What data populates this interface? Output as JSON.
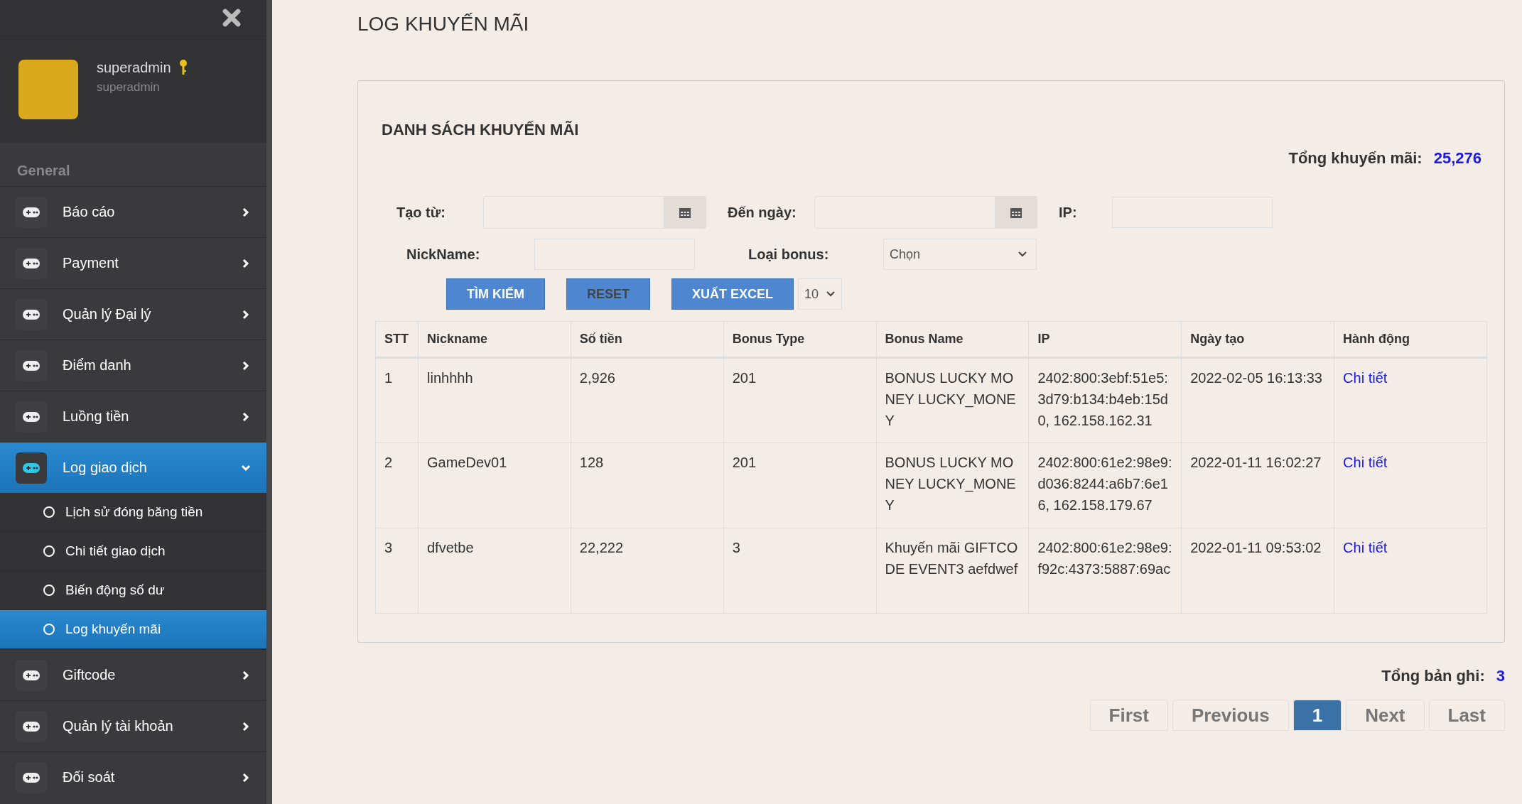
{
  "sidebar": {
    "user": {
      "name": "superadmin",
      "role": "superadmin"
    },
    "section": "General",
    "items": [
      {
        "label": "Báo cáo",
        "selected": false,
        "expanded": false
      },
      {
        "label": "Payment",
        "selected": false,
        "expanded": false
      },
      {
        "label": "Quản lý Đại lý",
        "selected": false,
        "expanded": false
      },
      {
        "label": "Điểm danh",
        "selected": false,
        "expanded": false
      },
      {
        "label": "Luồng tiền",
        "selected": false,
        "expanded": false
      },
      {
        "label": "Log giao dịch",
        "selected": true,
        "expanded": true,
        "children": [
          {
            "label": "Lịch sử đóng băng tiền",
            "selected": false
          },
          {
            "label": "Chi tiết giao dịch",
            "selected": false
          },
          {
            "label": "Biến động số dư",
            "selected": false
          },
          {
            "label": "Log khuyến mãi",
            "selected": true
          }
        ]
      },
      {
        "label": "Giftcode",
        "selected": false,
        "expanded": false
      },
      {
        "label": "Quản lý tài khoản",
        "selected": false,
        "expanded": false
      },
      {
        "label": "Đối soát",
        "selected": false,
        "expanded": false
      }
    ]
  },
  "page_title": "LOG KHUYẾN MÃI",
  "card": {
    "title": "DANH SÁCH KHUYẾN MÃI",
    "total_label": "Tổng khuyến mãi:",
    "total_value": "25,276",
    "filters": {
      "from_label": "Tạo từ:",
      "to_label": "Đến ngày:",
      "ip_label": "IP:",
      "nickname_label": "NickName:",
      "bonus_label": "Loại bonus:",
      "bonus_value": "Chọn"
    },
    "buttons": [
      "TÌM KIẾM",
      "RESET",
      "XUẤT EXCEL"
    ],
    "page_size": "10",
    "table": {
      "columns": [
        "STT",
        "Nickname",
        "Số tiền",
        "Bonus Type",
        "Bonus Name",
        "IP",
        "Ngày tạo",
        "Hành động"
      ],
      "rows": [
        [
          "1",
          "linhhhh",
          "2,926",
          "201",
          "BONUS LUCKY MONEY LUCKY_MONEY",
          "2402:800:3ebf:51e5:3d79:b134:b4eb:15d0, 162.158.162.31",
          "2022-02-05 16:13:33",
          "Chi tiết"
        ],
        [
          "2",
          "GameDev01",
          "128",
          "201",
          "BONUS LUCKY MONEY LUCKY_MONEY",
          "2402:800:61e2:98e9:d036:8244:a6b7:6e16, 162.158.179.67",
          "2022-01-11 16:02:27",
          "Chi tiết"
        ],
        [
          "3",
          "dfvetbe",
          "22,222",
          "3",
          "Khuyến mãi GIFTCODE EVENT3 aefdwef",
          "2402:800:61e2:98e9:f92c:4373:5887:69ac",
          "2022-01-11 09:53:02",
          "Chi tiết"
        ]
      ]
    }
  },
  "records_label": "Tổng bản ghi:",
  "records_value": "3",
  "pagination": [
    {
      "label": "First",
      "selected": false
    },
    {
      "label": "Previous",
      "selected": false
    },
    {
      "label": "1",
      "selected": true
    },
    {
      "label": "Next",
      "selected": false
    },
    {
      "label": "Last",
      "selected": false
    }
  ]
}
